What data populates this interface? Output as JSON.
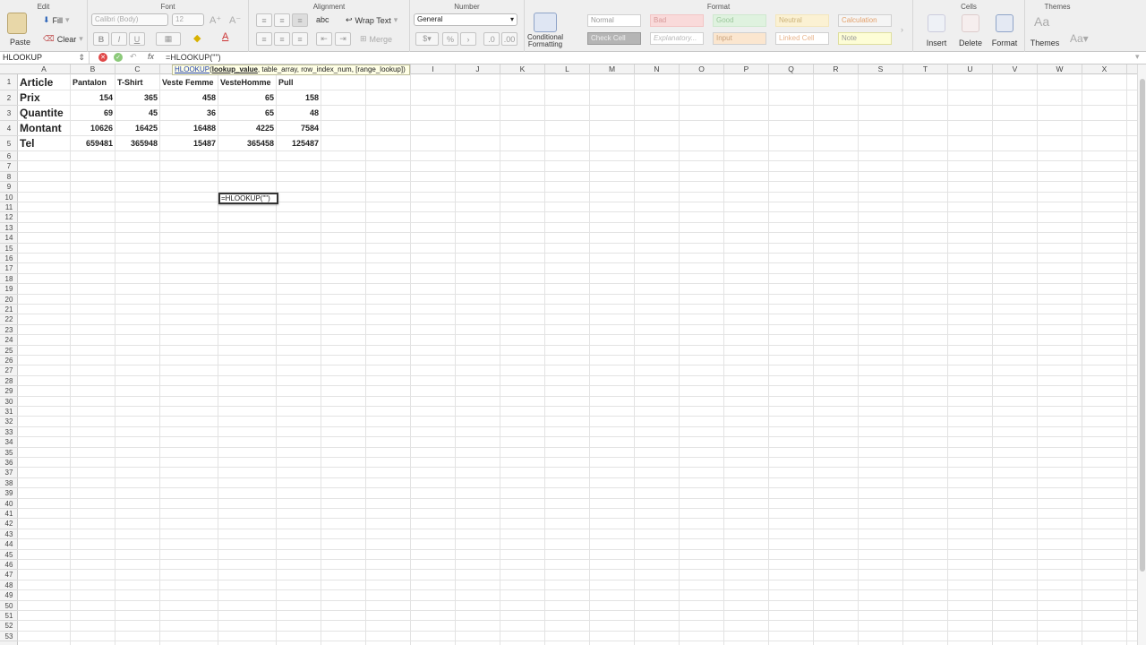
{
  "ribbon": {
    "groups": {
      "edit": "Edit",
      "font": "Font",
      "alignment": "Alignment",
      "number": "Number",
      "format": "Format",
      "cells": "Cells",
      "themes": "Themes"
    },
    "paste": "Paste",
    "fill": "Fill",
    "clear": "Clear",
    "font_name": "Calibri (Body)",
    "font_size": "12",
    "wrap_text": "Wrap Text",
    "merge": "Merge",
    "number_format": "General",
    "conditional_formatting": "Conditional Formatting",
    "styles": [
      "Normal",
      "Bad",
      "Good",
      "Neutral",
      "Calculation",
      "Check Cell",
      "Explanatory...",
      "Input",
      "Linked Cell",
      "Note"
    ],
    "insert": "Insert",
    "delete": "Delete",
    "format_btn": "Format",
    "themes_btn": "Themes",
    "bold": "B",
    "italic": "I",
    "underline": "U",
    "abc": "abc",
    "percent": "%",
    "fx": "fx"
  },
  "formula_bar": {
    "name_box": "HLOOKUP",
    "formula": "=HLOOKUP(\"\")"
  },
  "tooltip": {
    "func": "HLOOKUP",
    "paren": "(",
    "arg_active": "lookup_value",
    "args_rest": ", table_array, row_index_num, [range_lookup])"
  },
  "columns": [
    "A",
    "B",
    "C",
    "D",
    "E",
    "F",
    "G",
    "H",
    "I",
    "J",
    "K",
    "L",
    "M",
    "N",
    "O",
    "P",
    "Q",
    "R",
    "S",
    "T",
    "U",
    "V",
    "W",
    "X"
  ],
  "rows": [
    "1",
    "2",
    "3",
    "4",
    "5",
    "6",
    "7",
    "8",
    "9",
    "10",
    "11",
    "12",
    "13",
    "14",
    "15",
    "16",
    "17",
    "18",
    "19",
    "20",
    "21",
    "22",
    "23",
    "24",
    "25",
    "26",
    "27",
    "28",
    "29",
    "30",
    "31",
    "32",
    "33",
    "34",
    "35",
    "36",
    "37",
    "38",
    "39",
    "40",
    "41",
    "42",
    "43",
    "44",
    "45",
    "46",
    "47",
    "48",
    "49",
    "50",
    "51",
    "52",
    "53"
  ],
  "sheet": {
    "headers": [
      "Article",
      "Pantalon",
      "T-Shirt",
      "Veste Femme",
      "VesteHomme",
      "Pull"
    ],
    "data_rows": [
      {
        "label": "Prix",
        "values": [
          "154",
          "365",
          "458",
          "65",
          "158"
        ]
      },
      {
        "label": "Quantite",
        "values": [
          "69",
          "45",
          "36",
          "65",
          "48"
        ]
      },
      {
        "label": "Montant",
        "values": [
          "10626",
          "16425",
          "16488",
          "4225",
          "7584"
        ]
      },
      {
        "label": "Tel",
        "values": [
          "659481",
          "365948",
          "15487",
          "365458",
          "125487"
        ]
      }
    ],
    "edit_cell": "=HLOOKUP(\"\")"
  }
}
